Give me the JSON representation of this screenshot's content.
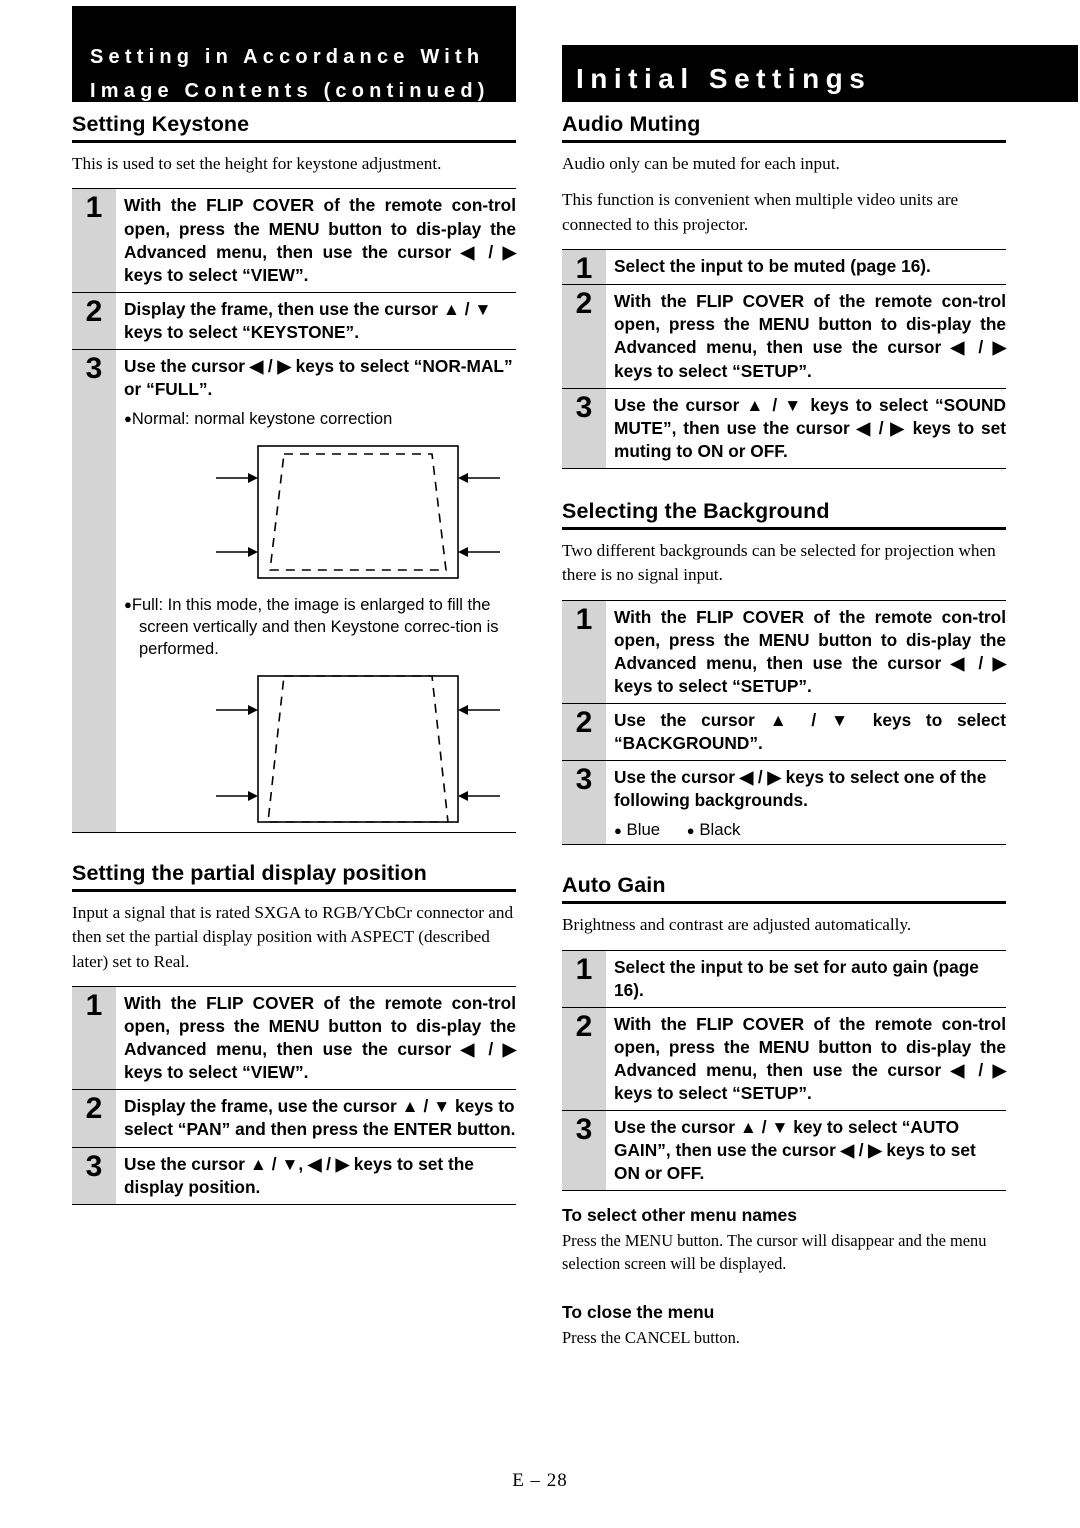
{
  "header": {
    "left_line1": "Setting in Accordance With",
    "left_line2": "Image Contents (continued)",
    "right_title": "Initial Settings"
  },
  "left_column": {
    "keystone": {
      "heading": "Setting Keystone",
      "intro": "This is used to set the height for keystone adjustment.",
      "steps": [
        {
          "num": "1",
          "text": "With the FLIP COVER of the remote con-trol open, press the MENU button to dis-play the Advanced menu, then use the cursor ◀ / ▶ keys to select “VIEW”."
        },
        {
          "num": "2",
          "text": "Display the frame, then use the cursor ▲ / ▼ keys to select “KEYSTONE”."
        },
        {
          "num": "3",
          "text": "Use the cursor ◀ / ▶ keys to select “NOR-MAL” or “FULL”."
        }
      ],
      "note_normal": "Normal: normal keystone correction",
      "note_full": "Full: In this mode, the image is enlarged to fill the screen vertically and then Keystone correc-tion is performed."
    },
    "partial": {
      "heading": "Setting the partial display position",
      "intro": "Input a signal that is rated SXGA to RGB/YCbCr connector and then set the partial display position with ASPECT (described later) set to Real.",
      "steps": [
        {
          "num": "1",
          "text": "With the FLIP COVER of the remote con-trol open, press the MENU button to dis-play the Advanced menu, then use the cursor ◀ / ▶ keys to select “VIEW”."
        },
        {
          "num": "2",
          "text": "Display the frame, use the cursor ▲ / ▼ keys to select “PAN” and then press the ENTER button."
        },
        {
          "num": "3",
          "text": "Use the cursor ▲ / ▼, ◀ / ▶ keys to set the display position."
        }
      ]
    }
  },
  "right_column": {
    "audio_muting": {
      "heading": "Audio Muting",
      "intro1": "Audio only can be muted for each input.",
      "intro2": "This function is convenient when multiple video units are connected to this projector.",
      "steps": [
        {
          "num": "1",
          "text": "Select the input to be muted (page 16)."
        },
        {
          "num": "2",
          "text": "With the FLIP COVER of the remote con-trol open, press the MENU button to dis-play the Advanced menu, then use the cursor ◀ / ▶ keys to select “SETUP”."
        },
        {
          "num": "3",
          "text": "Use the cursor ▲ / ▼ keys to select “SOUND MUTE”, then use the cursor ◀ / ▶ keys to set muting to ON or OFF."
        }
      ]
    },
    "background": {
      "heading": "Selecting the Background",
      "intro": "Two different backgrounds can be selected for projection when there is no signal input.",
      "steps": [
        {
          "num": "1",
          "text": "With the FLIP COVER of the remote con-trol open, press the MENU button to dis-play the Advanced menu, then use the cursor ◀ / ▶ keys to select “SETUP”."
        },
        {
          "num": "2",
          "text": "Use the cursor ▲ / ▼ keys to select “BACKGROUND”."
        },
        {
          "num": "3",
          "text": "Use the cursor ◀ / ▶ keys to select one of the following backgrounds."
        }
      ],
      "options": [
        "Blue",
        "Black"
      ]
    },
    "auto_gain": {
      "heading": "Auto Gain",
      "intro": "Brightness and contrast are adjusted automatically.",
      "steps": [
        {
          "num": "1",
          "text": "Select the input to be set for auto gain (page 16)."
        },
        {
          "num": "2",
          "text": "With the FLIP COVER of the remote con-trol open, press the MENU button to dis-play the Advanced menu, then use the cursor ◀ / ▶ keys to select “SETUP”."
        },
        {
          "num": "3",
          "text": "Use the cursor ▲ / ▼ key to select “AUTO GAIN”, then use the cursor ◀ / ▶ keys to set ON or OFF."
        }
      ]
    },
    "other_menu": {
      "heading": "To select other menu names",
      "text": "Press the MENU button. The cursor will disappear and the menu selection screen will be displayed."
    },
    "close_menu": {
      "heading": "To close the menu",
      "text": "Press the CANCEL button."
    }
  },
  "footer": {
    "page": "E – 28"
  }
}
